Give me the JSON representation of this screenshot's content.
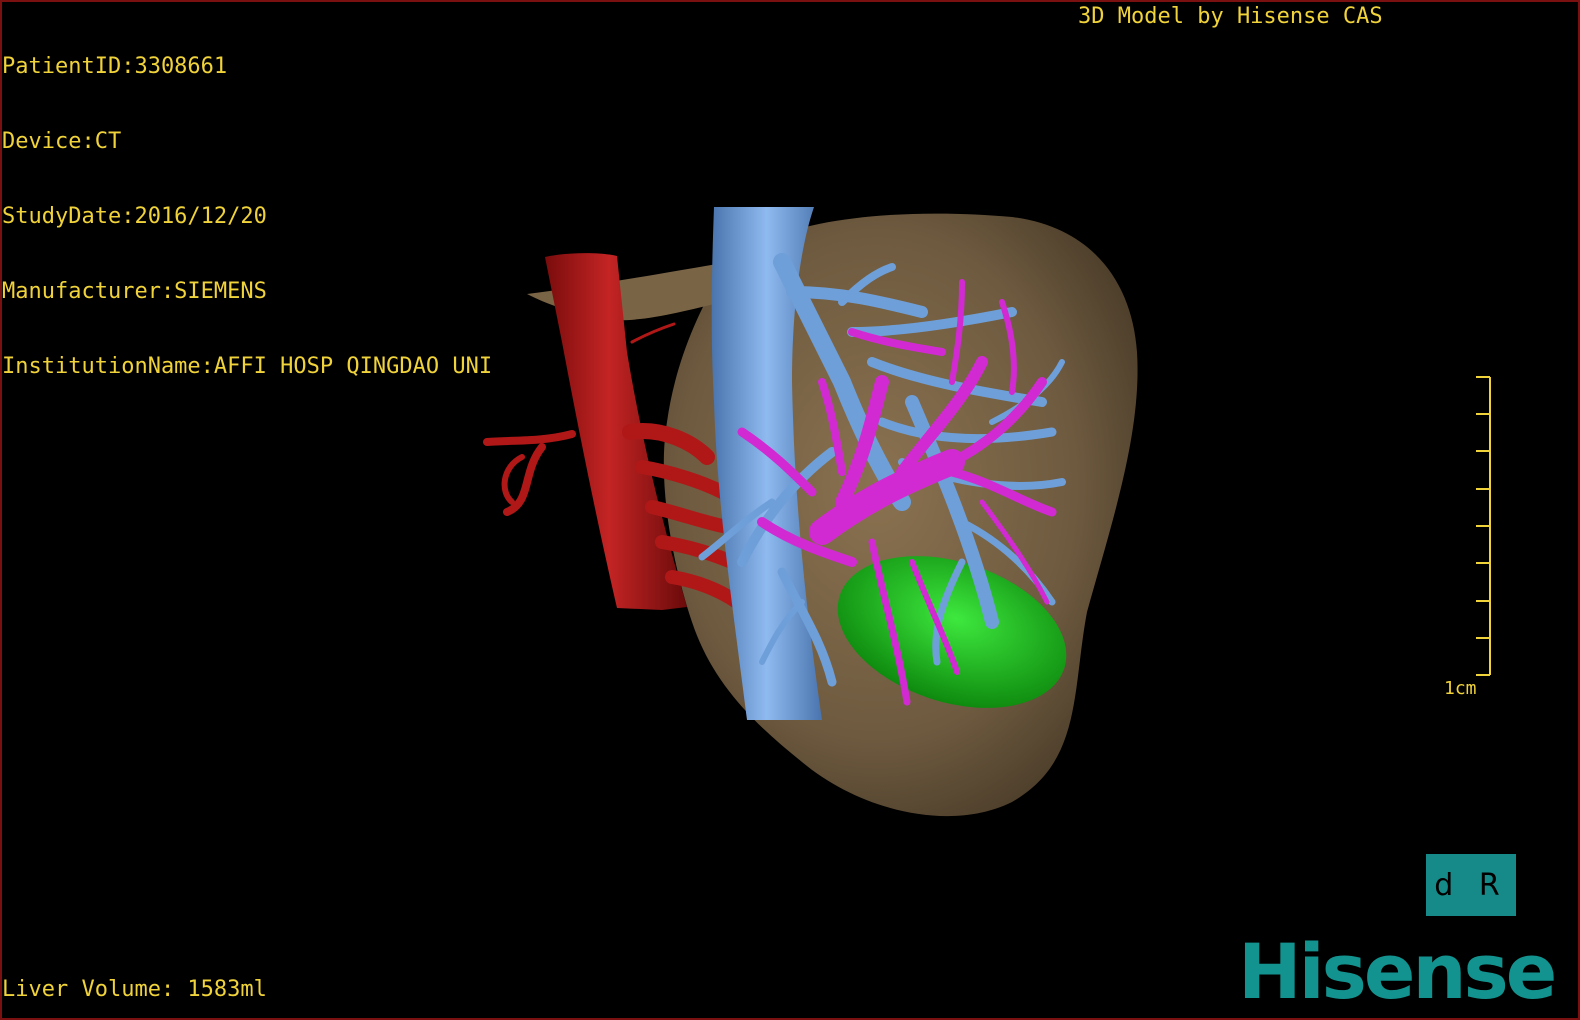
{
  "patient_info": {
    "lines": [
      "PatientID:3308661",
      "Device:CT",
      "StudyDate:2016/12/20",
      "Manufacturer:SIEMENS",
      "InstitutionName:AFFI HOSP QINGDAO UNI"
    ]
  },
  "model_credit": "3D Model by Hisense CAS",
  "liver_volume": "Liver Volume: 1583ml",
  "scale_bar": {
    "label": "1cm"
  },
  "orientation": {
    "label": "d R"
  },
  "brand": {
    "name": "Hisense"
  },
  "colors": {
    "overlay_text": "#f0d23a",
    "liver": "#6e5a3f",
    "artery": "#b01818",
    "vena_cava": "#6f9fd8",
    "portal_vein": "#d22ad2",
    "gallbladder": "#22c022",
    "brand": "#13938f",
    "border": "#7a1010"
  }
}
